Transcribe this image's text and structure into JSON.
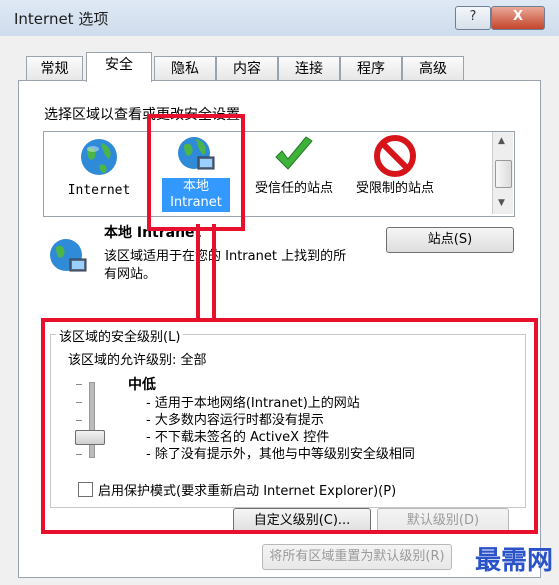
{
  "window": {
    "title": "Internet 选项",
    "help_label": "?",
    "close_label": "X"
  },
  "tabs": [
    {
      "label": "常规"
    },
    {
      "label": "安全"
    },
    {
      "label": "隐私"
    },
    {
      "label": "内容"
    },
    {
      "label": "连接"
    },
    {
      "label": "程序"
    },
    {
      "label": "高级"
    }
  ],
  "zones": {
    "prompt": "选择区域以查看或更改安全设置。",
    "items": [
      {
        "label": "Internet",
        "icon": "globe-icon"
      },
      {
        "label": "本地 Intranet",
        "icon": "intranet-globe-icon"
      },
      {
        "label": "受信任的站点",
        "icon": "check-icon"
      },
      {
        "label": "受限制的站点",
        "icon": "no-entry-icon"
      }
    ],
    "selected_index": 1
  },
  "selected_zone": {
    "name": "本地 Intranet",
    "description": "该区域适用于在您的 Intranet 上找到的所有网站。",
    "sites_button": "站点(S)"
  },
  "security": {
    "group_label": "该区域的安全级别(L)",
    "allowed_levels": "该区域的允许级别: 全部",
    "level_name": "中低",
    "level_fraction": 0.33,
    "bullets": [
      "- 适用于本地网络(Intranet)上的网站",
      "- 大多数内容运行时都没有提示",
      "- 不下载未签名的 ActiveX 控件",
      "- 除了没有提示外，其他与中等级别安全级相同"
    ],
    "protected_mode": {
      "label": "启用保护模式(要求重新启动 Internet Explorer)(P)",
      "checked": false
    },
    "custom_button": "自定义级别(C)...",
    "default_button": "默认级别(D)"
  },
  "reset_button": "将所有区域重置为默认级别(R)",
  "watermark": "最需网",
  "colors": {
    "highlight": "#e8112d",
    "selection": "#3399ff"
  }
}
